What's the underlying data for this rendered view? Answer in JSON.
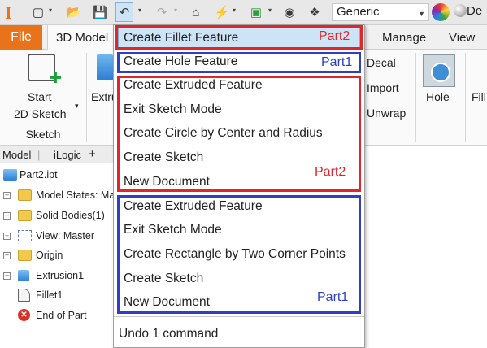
{
  "qat": {
    "combo_value": "Generic",
    "cutoff_text": "De",
    "icons": [
      "app-icon",
      "new-icon",
      "open-icon",
      "save-icon",
      "undo-icon",
      "redo-icon",
      "home-icon",
      "update-icon",
      "appearance-icon",
      "material-icon",
      "texture-icon"
    ]
  },
  "tabs": {
    "file": "File",
    "model": "3D Model",
    "manage": "Manage",
    "view": "View"
  },
  "ribbon": {
    "start_sketch_line1": "Start",
    "start_sketch_line2": "2D Sketch",
    "sketch_group": "Sketch",
    "extrude": "Extru",
    "decal": "Decal",
    "import": "Import",
    "unwrap": "Unwrap",
    "hole": "Hole",
    "fillet": "Fill"
  },
  "browser": {
    "tab_model": "Model",
    "tab_ilogic": "iLogic",
    "tab_add": "+",
    "items": [
      {
        "label": "Part2.ipt"
      },
      {
        "label": "Model States: Ma"
      },
      {
        "label": "Solid Bodies(1)"
      },
      {
        "label": "View: Master"
      },
      {
        "label": "Origin"
      },
      {
        "label": "Extrusion1"
      },
      {
        "label": "Fillet1"
      },
      {
        "label": "End of Part"
      }
    ]
  },
  "menu": {
    "items": [
      "Create Fillet Feature",
      "Create Hole Feature",
      "Create Extruded Feature",
      "Exit Sketch Mode",
      "Create Circle by Center and Radius",
      "Create Sketch",
      "New Document",
      "Create Extruded Feature",
      "Exit Sketch Mode",
      "Create Rectangle by Two Corner Points",
      "Create Sketch",
      "New Document"
    ],
    "footer": "Undo 1 command",
    "annotations": {
      "part2_top": "Part2",
      "part1_top": "Part1",
      "part2_mid": "Part2",
      "part1_bottom": "Part1"
    }
  },
  "colors": {
    "accent": "#e8731a",
    "annotation_red": "#e0262b",
    "annotation_blue": "#2f3fc4",
    "selection": "#cde4f7"
  }
}
